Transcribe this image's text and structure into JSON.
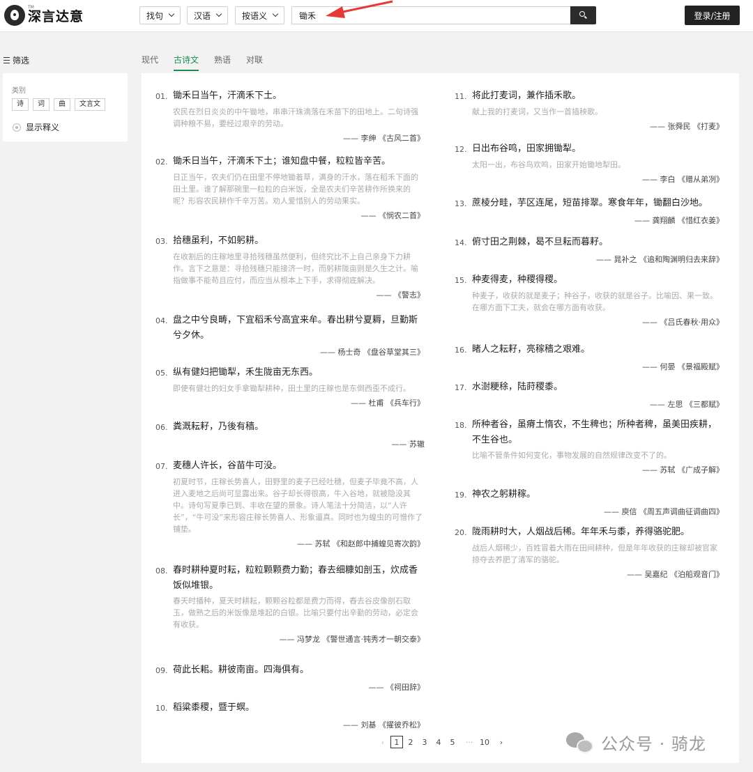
{
  "header": {
    "brand": "深言达意",
    "tm": "TM",
    "dropdowns": [
      "找句",
      "汉语",
      "按语义"
    ],
    "search_value": "锄禾",
    "login_label": "登录/注册"
  },
  "sidebar": {
    "filter_title": "筛选",
    "category_label": "类别",
    "tags": [
      "诗",
      "词",
      "曲",
      "文言文"
    ],
    "show_explain_label": "显示释义"
  },
  "tabs": [
    "现代",
    "古诗文",
    "熟语",
    "对联"
  ],
  "results_left": [
    {
      "num": "01.",
      "text": "锄禾日当午，汗滴禾下土。",
      "desc": "农民在烈日炎炎的中午锄地，串串汗珠滴落在禾苗下的田地上。二句诗强调种粮不易，要经过艰辛的劳动。",
      "source": "—— 李绅 《古风二首》"
    },
    {
      "num": "02.",
      "text": "锄禾日当午，汗滴禾下土；谁知盘中餐，粒粒皆辛苦。",
      "desc": "日正当午，农夫们仍在田里不停地锄着草，满身的汗水，落在稻禾下面的田土里。谁了解那碗里一粒粒的白米饭，全是农夫们辛苦耕作所换来的呢？形容农民耕作千辛万苦。劝人爱惜别人的劳动果实。",
      "source": "—— 《悯农二首》"
    },
    {
      "num": "03.",
      "text": "拾穗虽利，不如躬耕。",
      "desc": "在收割后的庄稼地里寻拾残穗虽然便利，但终究比不上自己亲身下力耕作。言下之意是：寻拾残穗只能接济一时，而躬耕陇亩则是久生之计。喻指做事不能苟且应付，而应当从根本上下手，求得彻底解决。",
      "source": "—— 《警志》"
    },
    {
      "num": "04.",
      "text": "盘之中兮良畴，下宜稻禾兮高宜来牟。春出耕兮夏耨，旦勤斯兮夕休。",
      "desc": "",
      "source": "—— 杨士奇 《盘谷草堂其三》"
    },
    {
      "num": "05.",
      "text": "纵有健妇把锄犁，禾生陇亩无东西。",
      "desc": "即使有健壮的妇女手拿锄犁耕种，田土里的庄稼也是东倒西歪不成行。",
      "source": "—— 杜甫 《兵车行》"
    },
    {
      "num": "06.",
      "text": "粪溉耘耔，乃後有穑。",
      "desc": "",
      "source": "—— 苏辙"
    },
    {
      "num": "07.",
      "text": "麦穗人许长，谷苗牛可没。",
      "desc": "初夏时节，庄稼长势喜人，田野里的麦子已经吐穗，但麦子毕竟不高，人进入麦地之后尚可显露出来。谷子却长得很高，牛入谷地，就被隐没其中。诗句写夏季已到、丰收在望的景象。诗人笔法十分简洁，以“人许长”，“牛可没”来形容庄稼长势喜人、形象逼真。同时也为蝗虫的可憎作了铺垫。",
      "source": "—— 苏轼 《和赵郎中捕蝗见寄次韵》"
    },
    {
      "num": "08.",
      "text": "春时耕种夏时耘，粒粒颗颗费力勤；春去细糠如剖玉，炊成香饭似堆银。",
      "desc": "春天时播种，夏天时耕耘，颗颗谷粒都是费力而得，舂去谷皮像剖石取玉，做熟之后的米饭像是堆起的白银。比喻只要付出辛勤的劳动，必定会有收获。",
      "source": "—— 冯梦龙 《警世通言·钝秀才一朝交泰》"
    },
    {
      "num": "09.",
      "text": "荷此长耜。耕彼南亩。四海俱有。",
      "desc": "",
      "source": "—— 《祠田辞》"
    },
    {
      "num": "10.",
      "text": "稻粱黍稷，暨于螟。",
      "desc": "",
      "source": "—— 刘基 《擢彼乔松》"
    }
  ],
  "results_right": [
    {
      "num": "11.",
      "text": "将此打麦词，兼作插禾歌。",
      "desc": "献上我的打麦词，又当作一首插秧歌。",
      "source": "—— 张舜民 《打麦》"
    },
    {
      "num": "12.",
      "text": "日出布谷鸣，田家拥锄犁。",
      "desc": "太阳一出，布谷鸟欢鸣，田家开始锄地犁田。",
      "source": "—— 李白 《赠从弟冽》"
    },
    {
      "num": "13.",
      "text": "蔗棱分畦，芋区连尾，短苗排翠。寒食年年，锄翻白沙地。",
      "desc": "",
      "source": "—— 龚翔麟 《惜红衣姜》"
    },
    {
      "num": "14.",
      "text": "俯寸田之荆棘，曷不旦耘而暮耔。",
      "desc": "",
      "source": "—— 晁补之 《追和陶渊明归去来辞》"
    },
    {
      "num": "15.",
      "text": "种麦得麦，种稷得稷。",
      "desc": "种麦子，收获的就是麦子；种谷子，收获的就是谷子。比喻因、果一致。在哪方面下工夫，就会在哪方面有收获。",
      "source": "—— 《吕氏春秋·用众》"
    },
    {
      "num": "16.",
      "text": "睹人之耘耔，亮稼穑之艰难。",
      "desc": "",
      "source": "—— 何晏 《景福殿赋》"
    },
    {
      "num": "17.",
      "text": "水澍粳稌，陆莳稷黍。",
      "desc": "",
      "source": "—— 左思 《三都赋》"
    },
    {
      "num": "18.",
      "text": "所种者谷，虽瘠土惰农，不生稗也；所种者稗，虽美田疾耕，不生谷也。",
      "desc": "比喻不管条件如何变化，事物发展的自然规律改变不了的。",
      "source": "—— 苏轼 《广成子解》"
    },
    {
      "num": "19.",
      "text": "神农之躬耕稼。",
      "desc": "",
      "source": "—— 庾信 《周五声调曲征调曲四》"
    },
    {
      "num": "20.",
      "text": "陇雨耕时大，人烟战后稀。年年禾与黍，养得骆驼肥。",
      "desc": "战后人烟稀少，百姓冒着大雨在田间耕种，但是年年收获的庄稼却被官家掠夺去养肥了清军的骆驼。",
      "source": "—— 吴嘉纪 《泊船观音门》"
    }
  ],
  "pagination": {
    "prev": "‹",
    "pages": [
      "1",
      "2",
      "3",
      "4",
      "5",
      "···",
      "10"
    ],
    "next": "›"
  },
  "watermark": "公众号 · 骑龙"
}
